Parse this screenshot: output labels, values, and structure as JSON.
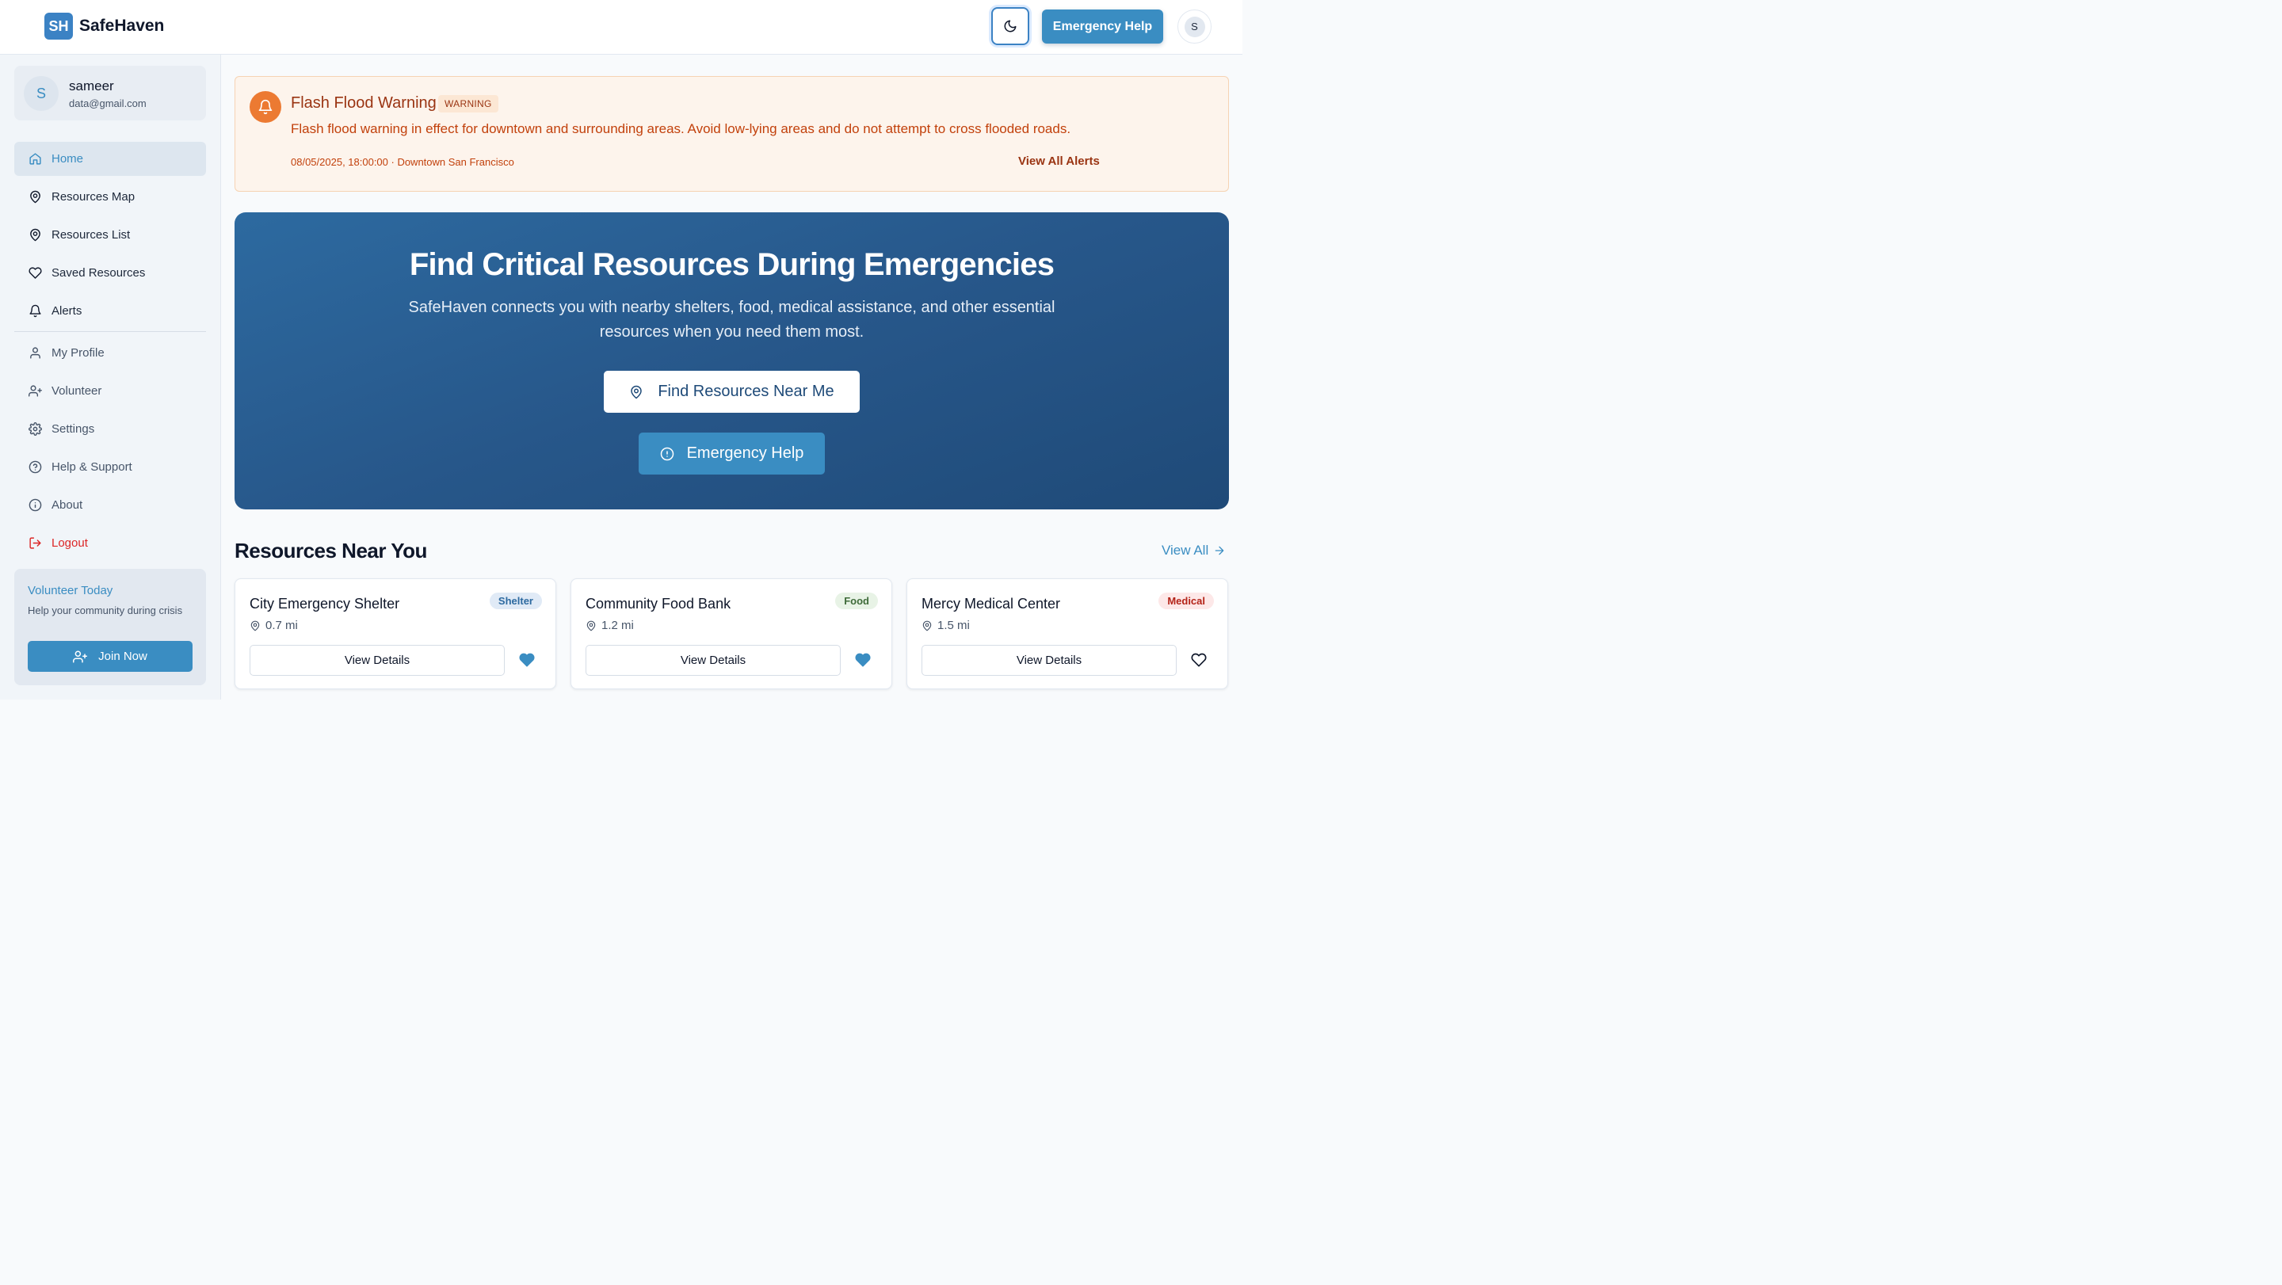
{
  "app": {
    "logo_badge": "SH",
    "name": "SafeHaven"
  },
  "header": {
    "theme_toggle": "moon-icon",
    "emergency_label": "Emergency Help",
    "avatar_initial": "S"
  },
  "user": {
    "initial": "S",
    "name": "sameer",
    "email": "data@gmail.com"
  },
  "sidebar": {
    "primary": [
      {
        "label": "Home",
        "icon": "home-icon",
        "active": true
      },
      {
        "label": "Resources Map",
        "icon": "map-pin-icon"
      },
      {
        "label": "Resources List",
        "icon": "map-pin-icon"
      },
      {
        "label": "Saved Resources",
        "icon": "heart-icon"
      },
      {
        "label": "Alerts",
        "icon": "bell-icon"
      }
    ],
    "secondary": [
      {
        "label": "My Profile",
        "icon": "user-icon"
      },
      {
        "label": "Volunteer",
        "icon": "user-plus-icon"
      },
      {
        "label": "Settings",
        "icon": "gear-icon"
      },
      {
        "label": "Help & Support",
        "icon": "help-circle-icon"
      },
      {
        "label": "About",
        "icon": "info-icon"
      },
      {
        "label": "Logout",
        "icon": "logout-icon"
      }
    ],
    "volunteer": {
      "title": "Volunteer Today",
      "text": "Help your community during crisis",
      "button": "Join Now"
    }
  },
  "alert": {
    "title": "Flash Flood Warning",
    "badge": "WARNING",
    "message": "Flash flood warning in effect for downtown and surrounding areas. Avoid low-lying areas and do not attempt to cross flooded roads.",
    "meta": "08/05/2025, 18:00:00 · Downtown San Francisco",
    "link": "View All Alerts",
    "color": "#ec7a32"
  },
  "hero": {
    "title": "Find Critical Resources During Emergencies",
    "subtitle": "SafeHaven connects you with nearby shelters, food, medical assistance, and other essential resources when you need them most.",
    "find_button": "Find Resources Near Me",
    "emergency_button": "Emergency Help"
  },
  "resources": {
    "title": "Resources Near You",
    "view_all": "View All",
    "items": [
      {
        "name": "City Emergency Shelter",
        "type": "Shelter",
        "distance": "0.7 mi",
        "button": "View Details",
        "saved": true
      },
      {
        "name": "Community Food Bank",
        "type": "Food",
        "distance": "1.2 mi",
        "button": "View Details",
        "saved": true
      },
      {
        "name": "Mercy Medical Center",
        "type": "Medical",
        "distance": "1.5 mi",
        "button": "View Details",
        "saved": false
      }
    ]
  },
  "colors": {
    "accent": "#3a8dc2",
    "hero": "#27578a",
    "alert_text": "#c2410c",
    "logout": "#dc2626"
  }
}
